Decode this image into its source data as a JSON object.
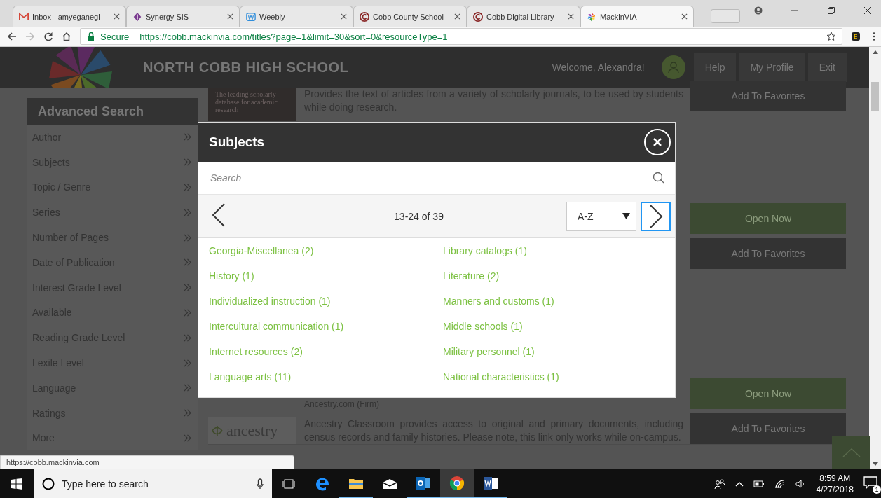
{
  "browser": {
    "tabs": [
      {
        "title": "Inbox - amyeganegi",
        "selected": false
      },
      {
        "title": "Synergy SIS",
        "selected": false
      },
      {
        "title": "Weebly",
        "selected": false
      },
      {
        "title": "Cobb County School",
        "selected": false
      },
      {
        "title": "Cobb Digital Library",
        "selected": false
      },
      {
        "title": "MackinVIA",
        "selected": true
      }
    ],
    "secure_label": "Secure",
    "url": "https://cobb.mackinvia.com/titles?page=1&limit=30&sort=0&resourceType=1"
  },
  "header": {
    "school": "NORTH COBB HIGH SCHOOL",
    "welcome": "Welcome, Alexandra!",
    "nav": [
      "Help",
      "My Profile",
      "Exit"
    ]
  },
  "sidebar": {
    "title": "Advanced Search",
    "items": [
      "Author",
      "Subjects",
      "Topic / Genre",
      "Series",
      "Number of Pages",
      "Date of Publication",
      "Interest Grade Level",
      "Available",
      "Reading Grade Level",
      "Lexile Level",
      "Language",
      "Ratings",
      "More"
    ]
  },
  "results": [
    {
      "cover": "The leading scholarly database for academic research",
      "description": "Provides the text of articles from a variety of scholarly journals, to be used by students while doing research.",
      "buttons": [
        "Add To Favorites"
      ]
    },
    {
      "buttons": [
        "Open Now",
        "Add To Favorites"
      ]
    },
    {
      "cover": "ancestry",
      "publisher": "Ancestry.com (Firm)",
      "description": "Ancestry Classroom provides access to original and primary documents, including census records and family histories. Please note, this link only works while on-campus.",
      "buttons": [
        "Open Now",
        "Add To Favorites"
      ]
    }
  ],
  "modal": {
    "title": "Subjects",
    "search_placeholder": "Search",
    "page_label": "13-24 of 39",
    "sort": "A-Z",
    "subjects": [
      "Georgia-Miscellanea (2)",
      "History (1)",
      "Individualized instruction (1)",
      "Intercultural communication (1)",
      "Internet resources (2)",
      "Language arts (11)",
      "Library catalogs (1)",
      "Literature (2)",
      "Manners and customs (1)",
      "Middle schools (1)",
      "Military personnel (1)",
      "National characteristics (1)"
    ]
  },
  "status_url": "https://cobb.mackinvia.com",
  "taskbar": {
    "search_placeholder": "Type here to search",
    "time": "8:59 AM",
    "date": "4/27/2018",
    "notifications": "1"
  }
}
